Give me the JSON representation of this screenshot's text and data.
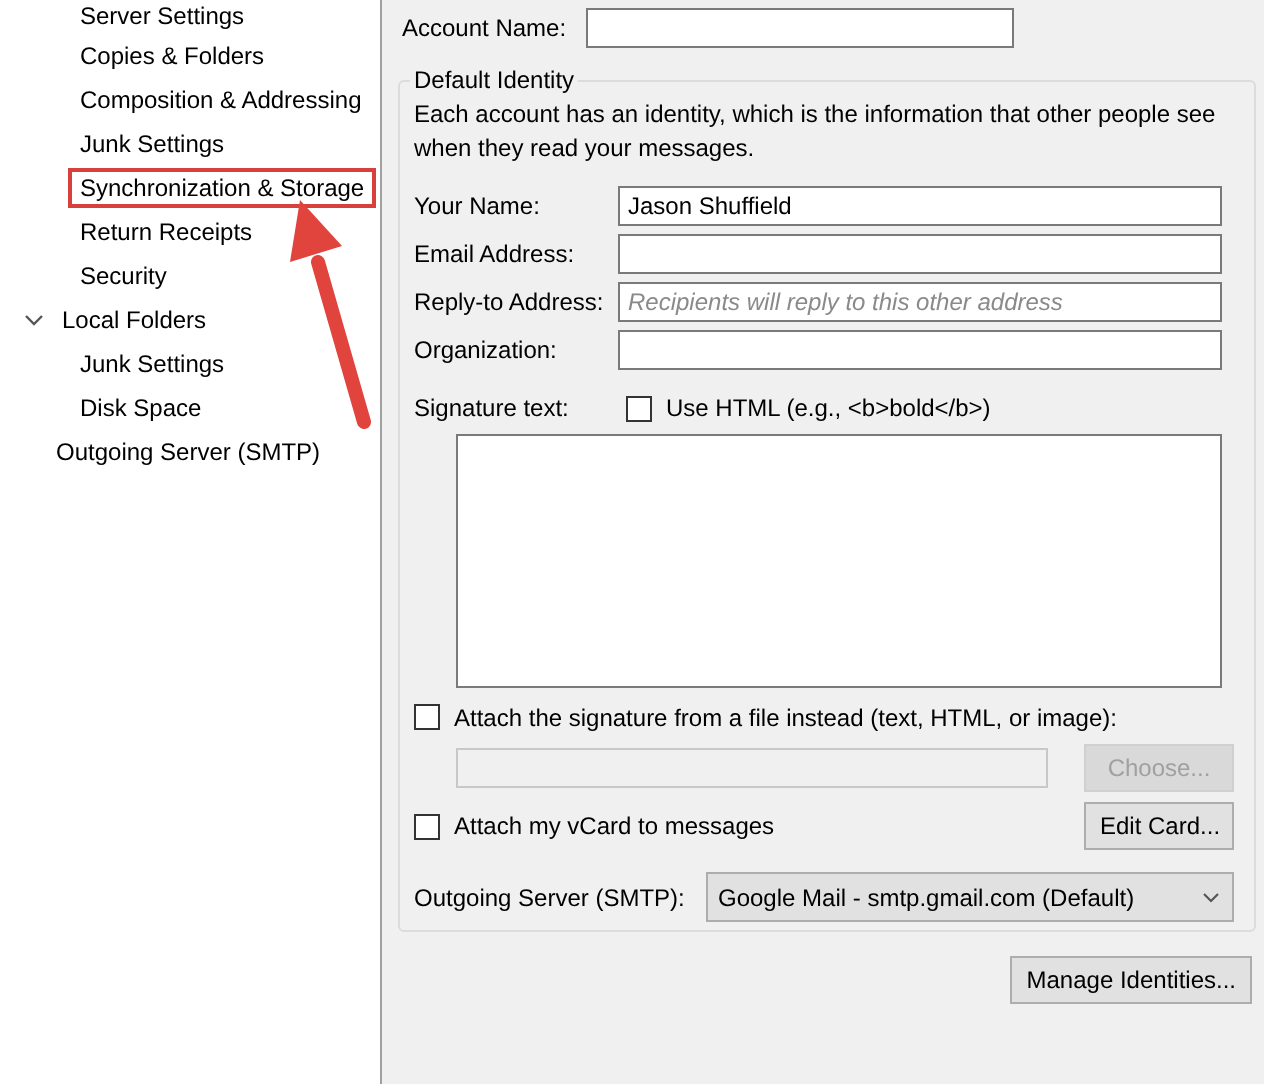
{
  "sidebar": {
    "account_children": [
      {
        "label": "Server Settings",
        "highlighted": false
      },
      {
        "label": "Copies & Folders",
        "highlighted": false
      },
      {
        "label": "Composition & Addressing",
        "highlighted": false
      },
      {
        "label": "Junk Settings",
        "highlighted": false
      },
      {
        "label": "Synchronization & Storage",
        "highlighted": true
      },
      {
        "label": "Return Receipts",
        "highlighted": false
      },
      {
        "label": "Security",
        "highlighted": false
      }
    ],
    "items": [
      {
        "label": "Local Folders",
        "expanded": true,
        "highlighted": false,
        "children": [
          {
            "label": "Junk Settings",
            "highlighted": false
          },
          {
            "label": "Disk Space",
            "highlighted": false
          }
        ]
      },
      {
        "label": "Outgoing Server (SMTP)",
        "highlighted": false
      }
    ]
  },
  "account_name": {
    "label": "Account Name:"
  },
  "identity": {
    "legend": "Default Identity",
    "description": "Each account has an identity, which is the information that other people see when they read your messages.",
    "fields": [
      {
        "label": "Your Name:",
        "value": "Jason Shuffield"
      },
      {
        "label": "Email Address:"
      },
      {
        "label": "Reply-to Address:",
        "placeholder": "Recipients will reply to this other address"
      },
      {
        "label": "Organization:"
      }
    ],
    "signature": {
      "label": "Signature text:",
      "use_html": {
        "label": "Use HTML (e.g., <b>bold</b>)",
        "checked": false
      }
    },
    "attach_file": {
      "label": "Attach the signature from a file instead (text, HTML, or image):",
      "checked": false,
      "choose_button": {
        "label": "Choose...",
        "disabled": true
      }
    },
    "vcard": {
      "label": "Attach my vCard to messages",
      "checked": false,
      "edit_button": {
        "label": "Edit Card...",
        "disabled": false
      }
    },
    "outgoing": {
      "label": "Outgoing Server (SMTP):",
      "value": "Google Mail - smtp.gmail.com (Default)"
    }
  },
  "manage_button": "Manage Identities..."
}
